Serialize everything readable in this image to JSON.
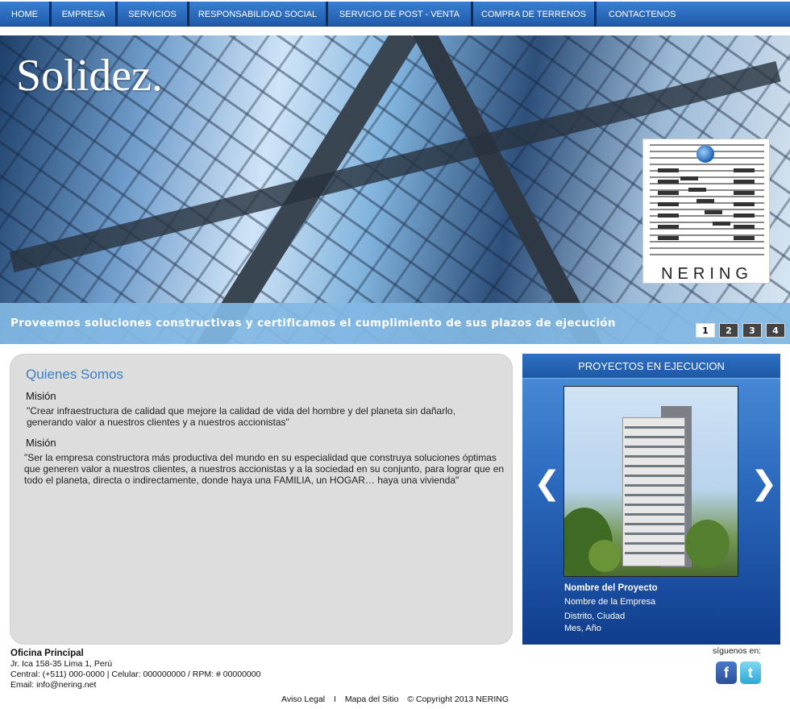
{
  "nav": {
    "items": [
      "HOME",
      "EMPRESA",
      "SERVICIOS",
      "RESPONSABILIDAD SOCIAL",
      "SERVICIO DE POST - VENTA",
      "COMPRA DE TERRENOS",
      "CONTACTENOS"
    ]
  },
  "hero": {
    "title": "Solidez.",
    "logo_text": "NERING",
    "caption": "Proveemos soluciones constructivas y certificamos el cumplimiento de sus plazos de ejecución",
    "pager": [
      "1",
      "2",
      "3",
      "4"
    ],
    "active_page": "1"
  },
  "about": {
    "heading": "Quienes Somos",
    "mision1_title": "Misión",
    "mision1_text": "\"Crear infraestructura de calidad que mejore la calidad de vida del hombre y del planeta sin dañarlo, generando valor a nuestros clientes y a nuestros accionistas\"",
    "mision2_title": "Misión",
    "mision2_text": "\"Ser la empresa constructora más productiva del mundo  en su especialidad que construya soluciones óptimas que generen valor a nuestros clientes, a nuestros accionistas y a la sociedad en su conjunto, para lograr que en todo el planeta, directa o indirectamente, donde haya una FAMILIA, un HOGAR… haya una vivienda\""
  },
  "projects": {
    "heading": "PROYECTOS EN EJECUCION",
    "name": "Nombre del Proyecto",
    "company": "Nombre de la Empresa",
    "location": "Distrito, Ciudad",
    "date": "Mes, Año",
    "prev_icon": "chevron-left-icon",
    "next_icon": "chevron-right-icon"
  },
  "footer": {
    "office_title": "Oficina Principal",
    "address": "Jr. Ica 158-35 Lima 1, Perú",
    "phones": "Central: (+511) 000-0000 | Celular: 000000000 / RPM: # 00000000",
    "email": "Email: info@nering.net",
    "follow": "síguenos en:",
    "facebook_glyph": "f",
    "twitter_glyph": "t",
    "link_legal": "Aviso Legal",
    "sep": "I",
    "link_map": "Mapa del Sitio",
    "copyright": "© Copyright 2013 NERING"
  }
}
